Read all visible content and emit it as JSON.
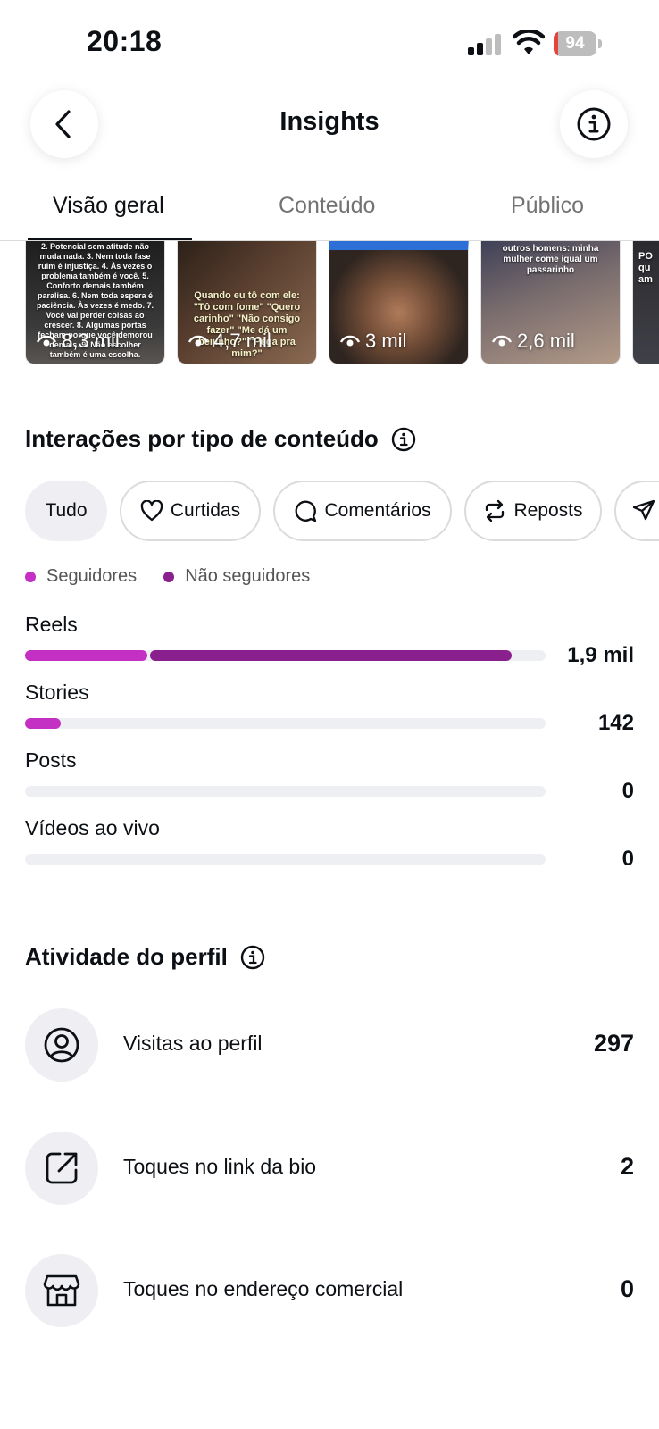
{
  "status_bar": {
    "time": "20:18",
    "battery": "94"
  },
  "header": {
    "title": "Insights"
  },
  "tabs": [
    {
      "label": "Visão geral",
      "active": true
    },
    {
      "label": "Conteúdo",
      "active": false
    },
    {
      "label": "Público",
      "active": false
    }
  ],
  "thumbnails": [
    {
      "views": "8,3 mil",
      "caption": "2. Potencial sem atitude não muda nada. 3. Nem toda fase ruim é injustiça. 4. Às vezes o problema também é você. 5. Conforto demais também paralisa. 6. Nem toda espera é paciência. Às vezes é medo. 7. Você vai perder coisas ao crescer. 8. Algumas portas fecham porque você demorou demais. 9. Não escolher também é uma escolha."
    },
    {
      "views": "4,7 mil",
      "caption": "Quando eu tô com ele: \"Tô com fome\" \"Quero carinho\" \"Não consigo fazer\" \"Me dá um beijinho?\" \"Pega pra mim?\""
    },
    {
      "views": "3 mil",
      "caption": ""
    },
    {
      "views": "2,6 mil",
      "caption": "outros homens: minha mulher come igual um passarinho"
    },
    {
      "views": "",
      "caption": "PO qu am"
    }
  ],
  "interactions": {
    "title": "Interações por tipo de conteúdo",
    "filters": [
      {
        "label": "Tudo",
        "icon": "",
        "selected": true
      },
      {
        "label": "Curtidas",
        "icon": "heart-icon",
        "selected": false
      },
      {
        "label": "Comentários",
        "icon": "comment-icon",
        "selected": false
      },
      {
        "label": "Reposts",
        "icon": "repost-icon",
        "selected": false
      },
      {
        "label": "",
        "icon": "share-icon",
        "selected": false
      }
    ],
    "legend": [
      {
        "label": "Seguidores",
        "color": "#c42fc4"
      },
      {
        "label": "Não seguidores",
        "color": "#8a1f8e"
      }
    ],
    "rows": [
      {
        "label": "Reels",
        "value": "1,9 mil",
        "followers_frac": 0.235,
        "nonfollowers_frac": 0.695
      },
      {
        "label": "Stories",
        "value": "142",
        "followers_frac": 0.068,
        "nonfollowers_frac": 0
      },
      {
        "label": "Posts",
        "value": "0",
        "followers_frac": 0,
        "nonfollowers_frac": 0
      },
      {
        "label": "Vídeos ao vivo",
        "value": "0",
        "followers_frac": 0,
        "nonfollowers_frac": 0
      }
    ]
  },
  "profile_activity": {
    "title": "Atividade do perfil",
    "items": [
      {
        "label": "Visitas ao perfil",
        "value": "297",
        "icon": "profile-icon"
      },
      {
        "label": "Toques no link da bio",
        "value": "2",
        "icon": "external-link-icon"
      },
      {
        "label": "Toques no endereço comercial",
        "value": "0",
        "icon": "store-icon"
      }
    ]
  }
}
